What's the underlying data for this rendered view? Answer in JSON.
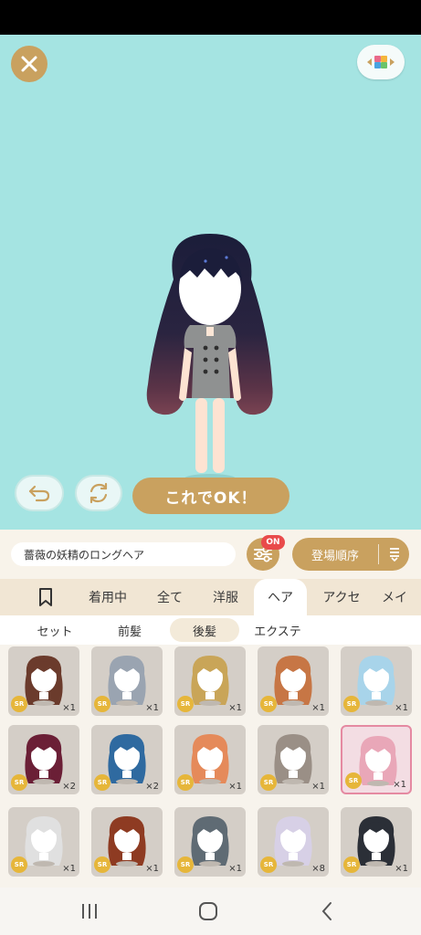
{
  "buttons": {
    "ok_label": "これでOK！"
  },
  "item": {
    "name": "薔薇の妖精のロングヘア"
  },
  "filter": {
    "badge": "ON"
  },
  "sort": {
    "label": "登場順序"
  },
  "tabs": [
    {
      "label": "着用中"
    },
    {
      "label": "全て"
    },
    {
      "label": "洋服"
    },
    {
      "label": "ヘア",
      "active": true
    },
    {
      "label": "アクセ"
    },
    {
      "label": "メイ"
    }
  ],
  "subtabs": [
    {
      "label": "セット"
    },
    {
      "label": "前髪"
    },
    {
      "label": "後髪",
      "active": true
    },
    {
      "label": "エクステ"
    }
  ],
  "items": [
    {
      "rarity": "SR",
      "qty": "×1",
      "hair_color": "#6b3b2c"
    },
    {
      "rarity": "SR",
      "qty": "×1",
      "hair_color": "#9aa4b1"
    },
    {
      "rarity": "SR",
      "qty": "×1",
      "hair_color": "#c9a558"
    },
    {
      "rarity": "SR",
      "qty": "×1",
      "hair_color": "#c77645"
    },
    {
      "rarity": "SR",
      "qty": "×1",
      "hair_color": "#a8d4ea"
    },
    {
      "rarity": "SR",
      "qty": "×2",
      "hair_color": "#6b1f36"
    },
    {
      "rarity": "SR",
      "qty": "×2",
      "hair_color": "#2f6aa0"
    },
    {
      "rarity": "SR",
      "qty": "×1",
      "hair_color": "#e58a5a"
    },
    {
      "rarity": "SR",
      "qty": "×1",
      "hair_color": "#9a8f86"
    },
    {
      "rarity": "SR",
      "qty": "×1",
      "hair_color": "#e9a7b8",
      "selected": true
    },
    {
      "rarity": "SR",
      "qty": "×1",
      "hair_color": "#e0e0e0"
    },
    {
      "rarity": "SR",
      "qty": "×1",
      "hair_color": "#8e3b22"
    },
    {
      "rarity": "SR",
      "qty": "×1",
      "hair_color": "#5f6b74"
    },
    {
      "rarity": "SR",
      "qty": "×8",
      "hair_color": "#d7d0e6"
    },
    {
      "rarity": "SR",
      "qty": "×1",
      "hair_color": "#2b2f37"
    }
  ],
  "colors": {
    "stage_bg": "#a5e4e2",
    "accent": "#c9a15f",
    "badge": "#e94b4b"
  }
}
